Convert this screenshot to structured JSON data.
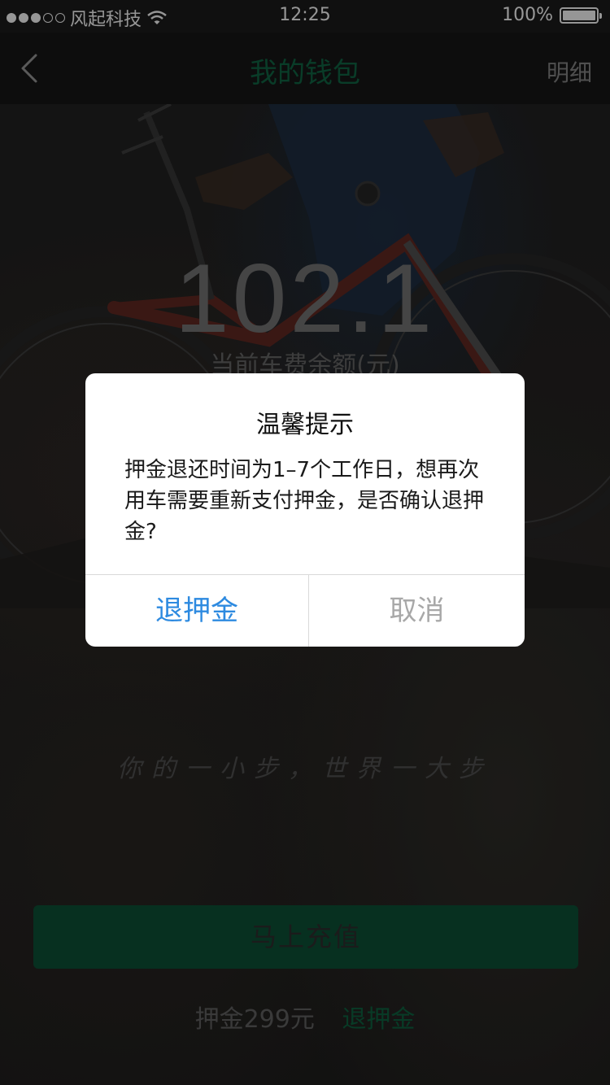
{
  "status_bar": {
    "carrier": "风起科技",
    "time": "12:25",
    "battery_percent": "100%",
    "battery_level": 1.0,
    "signal_strength": 3,
    "signal_max": 5
  },
  "nav": {
    "title": "我的钱包",
    "detail_label": "明细",
    "back_icon": "chevron-left-icon"
  },
  "wallet": {
    "balance": "102.1",
    "balance_label": "当前车费余额(元)",
    "slogan": "你的一小步，世界一大步",
    "recharge_label": "马上充值",
    "deposit_text": "押金299元",
    "refund_label": "退押金"
  },
  "dialog": {
    "title": "温馨提示",
    "message": "押金退还时间为1–7个工作日，想再次用车需要重新支付押金，是否确认退押金?",
    "confirm_label": "退押金",
    "cancel_label": "取消"
  },
  "colors": {
    "accent_green": "#0e5d3e",
    "dialog_confirm_blue": "#2d8ae0",
    "dialog_cancel_gray": "#a8a8a8"
  }
}
